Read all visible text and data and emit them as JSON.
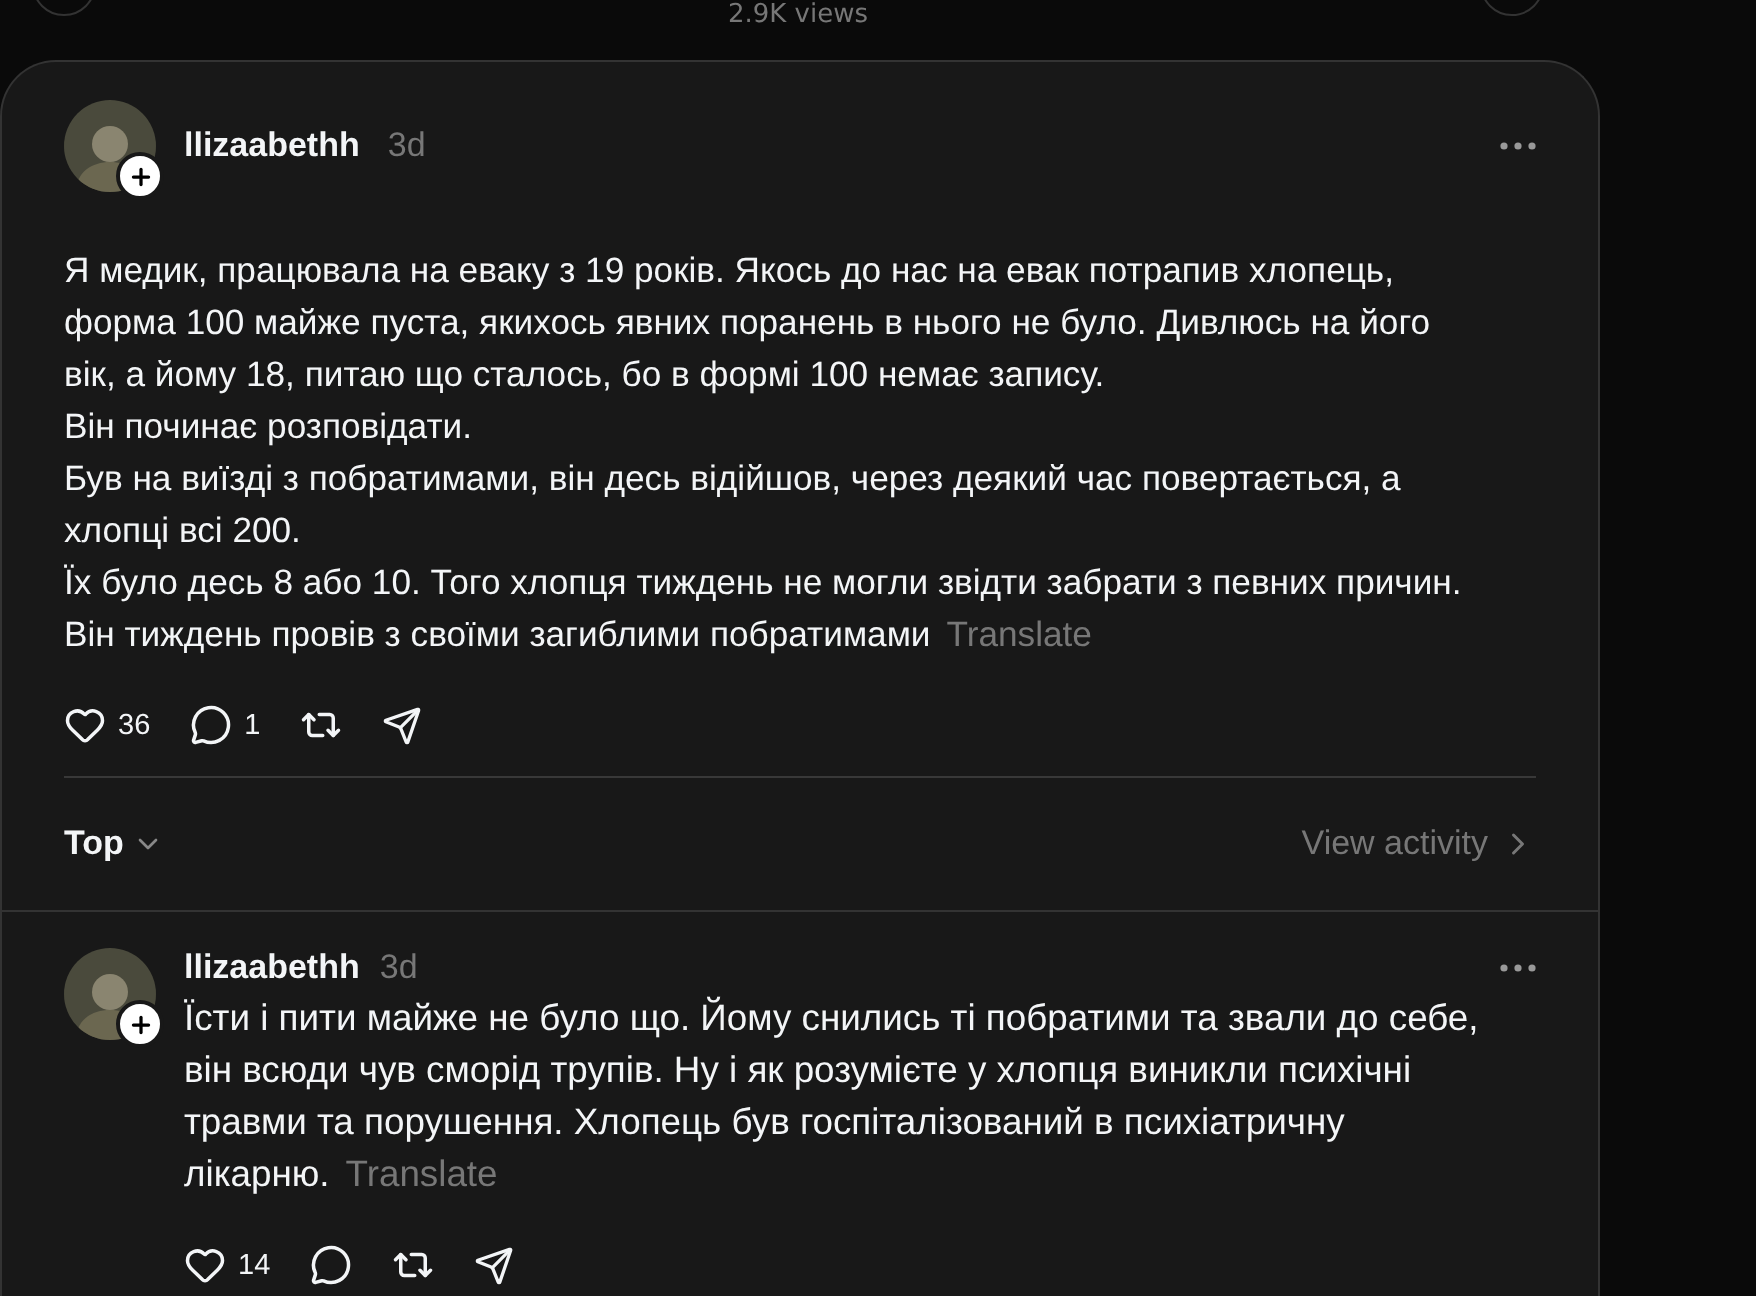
{
  "previous_post": {
    "views": "2.9K views"
  },
  "post": {
    "author": "llizaabethh",
    "time": "3d",
    "text": "Я медик, працювала на еваку з 19 років. Якось до нас на евак потрапив хлопець, форма 100 майже пуста, якихось явних поранень в нього не було. Дивлюсь на його вік, а йому 18, питаю що сталось, бо в формі 100 немає запису.\nВін починає розповідати.\nБув на виїзді з побратимами, він десь відійшов, через деякий час повертається, а хлопці всі 200.\nЇх було десь 8 або 10. Того хлопця тиждень не могли звідти забрати з певних причин. Він тиждень провів з своїми загиблими побратимами",
    "translate": "Translate",
    "likes": "36",
    "replies": "1"
  },
  "sort": {
    "label": "Top",
    "activity": "View activity"
  },
  "replies": [
    {
      "author": "llizaabethh",
      "time": "3d",
      "text": "Їсти і пити майже не було що. Йому снились ті побратими та звали до себе, він всюди чув сморід трупів. Ну і як розумієте у хлопця виникли психічні травми та порушення. Хлопець був госпіталізований в психіатричну лікарню.",
      "translate": "Translate",
      "likes": "14"
    }
  ]
}
